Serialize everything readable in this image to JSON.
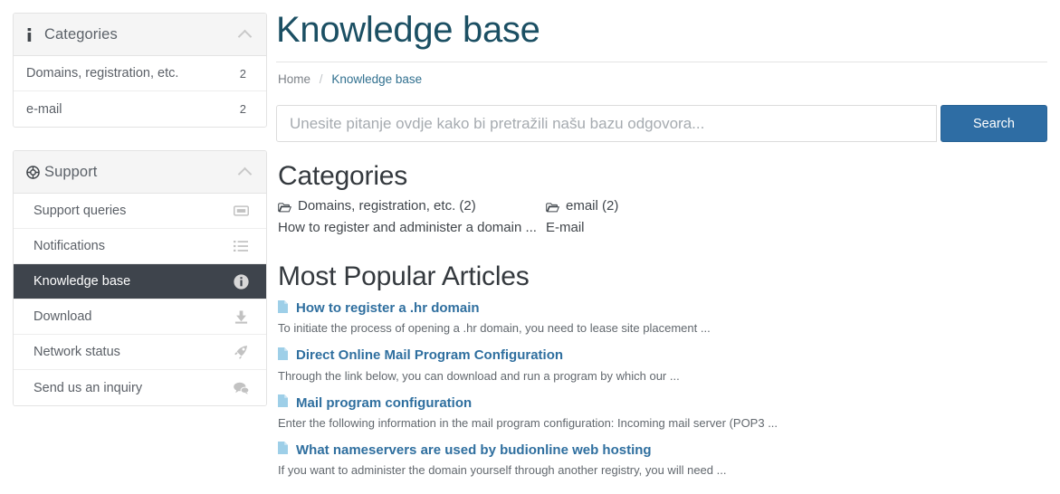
{
  "sidebar": {
    "categories_panel": {
      "icon": "info-i-icon",
      "title": "Categories",
      "collapse_icon": "chevron-up-icon",
      "items": [
        {
          "label": "Domains, registration, etc.",
          "count": "2"
        },
        {
          "label": "e-mail",
          "count": "2"
        }
      ]
    },
    "support_panel": {
      "icon": "life-ring-icon",
      "title": "Support",
      "collapse_icon": "chevron-up-icon",
      "items": [
        {
          "label": "Support queries",
          "icon": "ticket-icon",
          "active": false
        },
        {
          "label": "Notifications",
          "icon": "list-icon",
          "active": false
        },
        {
          "label": "Knowledge base",
          "icon": "info-circle-icon",
          "active": true
        },
        {
          "label": "Download",
          "icon": "download-icon",
          "active": false
        },
        {
          "label": "Network status",
          "icon": "rocket-icon",
          "active": false
        },
        {
          "label": "Send us an inquiry",
          "icon": "comments-icon",
          "active": false
        }
      ]
    }
  },
  "main": {
    "page_title": "Knowledge base",
    "breadcrumb": {
      "home": "Home",
      "separator": "/",
      "current": "Knowledge base"
    },
    "search": {
      "placeholder": "Unesite pitanje ovdje kako bi pretražili našu bazu odgovora...",
      "value": "",
      "button_label": "Search"
    },
    "categories_section": {
      "title": "Categories",
      "items": [
        {
          "icon": "folder-open-icon",
          "name": "Domains, registration, etc. (2)",
          "description": "How to register and administer a domain ..."
        },
        {
          "icon": "folder-open-icon",
          "name": "email (2)",
          "description": "E-mail"
        }
      ]
    },
    "articles_section": {
      "title": "Most Popular Articles",
      "items": [
        {
          "icon": "file-icon",
          "title": "How to register a .hr domain",
          "excerpt": "To initiate the process of opening a .hr domain, you need to lease site placement ..."
        },
        {
          "icon": "file-icon",
          "title": "Direct Online Mail Program Configuration",
          "excerpt": "Through the link below, you can download and run a program by which our ..."
        },
        {
          "icon": "file-icon",
          "title": "Mail program configuration",
          "excerpt": "Enter the following information in the mail program configuration: Incoming mail server (POP3 ..."
        },
        {
          "icon": "file-icon",
          "title": "What nameservers are used by budionline web hosting",
          "excerpt": "If you want to administer the domain yourself through another registry, you will need ..."
        }
      ]
    }
  },
  "colors": {
    "accent_blue": "#2e6da4",
    "title_teal": "#1b4f63",
    "active_nav": "#3e444c",
    "link_blue": "#2f6f9f",
    "doc_icon_blue": "#9ecfe8"
  }
}
